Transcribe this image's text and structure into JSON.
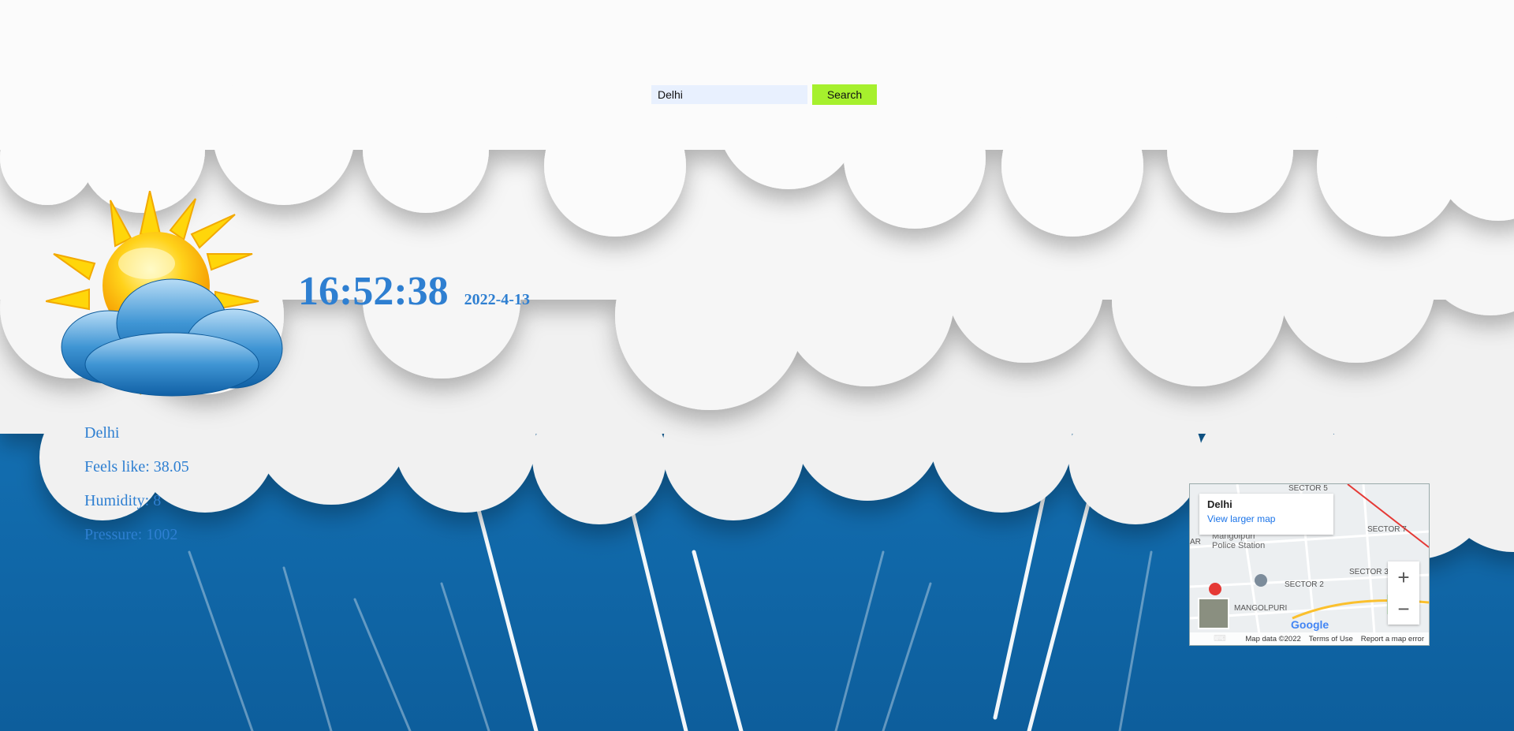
{
  "search": {
    "value": "Delhi",
    "button_label": "Search"
  },
  "clock": {
    "time": "16:52:38",
    "date": "2022-4-13"
  },
  "weather": {
    "city": "Delhi",
    "feels_like": "Feels like: 38.05",
    "humidity": "Humidity: 8",
    "pressure": "Pressure: 1002",
    "icon": "sun-behind-cloud-icon"
  },
  "map": {
    "place": "Delhi",
    "view_larger": "View larger map",
    "zoom_in": "+",
    "zoom_out": "−",
    "logo": "Google",
    "map_data": "Map data ©2022",
    "terms": "Terms of Use",
    "report": "Report a map error",
    "labels": [
      "SECTOR 5",
      "SECTOR 7",
      "Mangolpuri Police Station",
      "SECTOR 2",
      "SECTOR 3",
      "MANGOLPURI",
      "AR"
    ]
  },
  "colors": {
    "text": "#2e7fd1",
    "button": "#a6f02d",
    "input_bg": "#e8f0fe"
  }
}
